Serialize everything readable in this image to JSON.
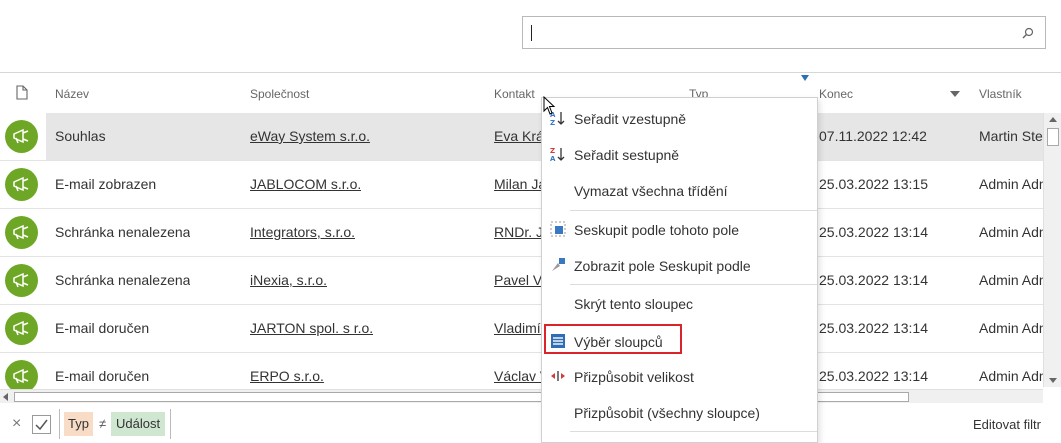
{
  "search": {
    "value": ""
  },
  "columns": [
    "Název",
    "Společnost",
    "Kontakt",
    "Typ",
    "Konec",
    "Vlastník"
  ],
  "rows": [
    {
      "name": "Souhlas",
      "company": "eWay System s.r.o.",
      "contact": "Eva Krásná",
      "end": "07.11.2022 12:42",
      "owner": "Martin Stehlík",
      "selected": true
    },
    {
      "name": "E-mail zobrazen",
      "company": "JABLOCOM s.r.o.",
      "contact": "Milan Jablonský",
      "end": "25.03.2022 13:15",
      "owner": "Admin Admin"
    },
    {
      "name": "Schránka nenalezena",
      "company": "Integrators, s.r.o.",
      "contact": "RNDr. Jiří",
      "end": "25.03.2022 13:14",
      "owner": "Admin Admin"
    },
    {
      "name": "Schránka nenalezena",
      "company": "iNexia, s.r.o.",
      "contact": "Pavel Vít",
      "end": "25.03.2022 13:14",
      "owner": "Admin Admin"
    },
    {
      "name": "E-mail doručen",
      "company": "JARTON spol. s r.o.",
      "contact": "Vladimír",
      "end": "25.03.2022 13:14",
      "owner": "Admin Admin"
    },
    {
      "name": "E-mail doručen",
      "company": "ERPO s.r.o.",
      "contact": "Václav V",
      "end": "25.03.2022 13:14",
      "owner": "Admin Admin"
    }
  ],
  "menu": {
    "sort_asc": "Seřadit vzestupně",
    "sort_desc": "Seřadit sestupně",
    "clear_sort": "Vymazat všechna třídění",
    "group_by": "Seskupit podle tohoto pole",
    "show_group_panel": "Zobrazit pole Seskupit podle",
    "hide_column": "Skrýt tento sloupec",
    "column_chooser": "Výběr sloupců",
    "best_fit": "Přizpůsobit velikost",
    "best_fit_all": "Přizpůsobit (všechny sloupce)"
  },
  "footer": {
    "close": "×",
    "filter_field": "Typ",
    "operator": "≠",
    "filter_value": "Událost",
    "edit_filter": "Editovat filtr"
  },
  "colors": {
    "accent_green": "#6ea725",
    "highlight_red": "#d9252a",
    "selected_row": "#e6e6e6",
    "filter_field_bg": "#f9dcc6",
    "filter_value_bg": "#cfe6d0"
  },
  "icons": [
    "search-icon",
    "document-icon",
    "megaphone-icon",
    "sort-asc-icon",
    "sort-desc-icon",
    "group-icon",
    "group-panel-icon",
    "column-chooser-icon",
    "best-fit-icon",
    "check-icon",
    "filter-icon"
  ]
}
